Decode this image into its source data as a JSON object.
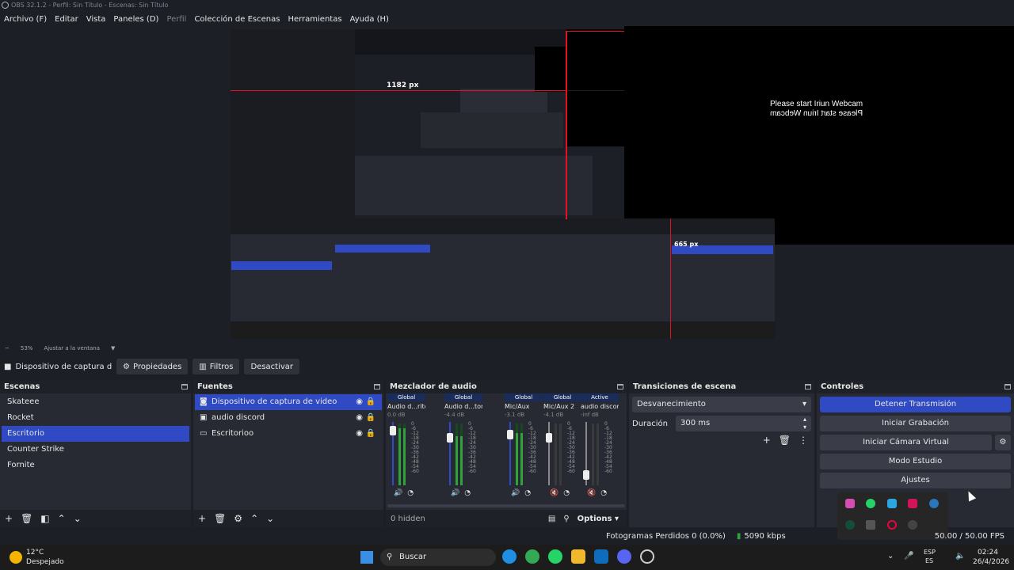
{
  "window": {
    "title": "OBS 32.1.2 - Perfil: Sin Título - Escenas: Sin Título"
  },
  "menu": [
    "Archivo (F)",
    "Editar",
    "Vista",
    "Paneles (D)",
    "Perfil",
    "Colección de Escenas",
    "Herramientas",
    "Ayuda (H)"
  ],
  "preview": {
    "iriun_text": "Please start Iriun Webcam",
    "measure_h": "1182 px",
    "measure_v": "665 px",
    "zoom": "53%",
    "fit_label": "Ajustar a la ventana"
  },
  "toolbar": {
    "source_name": "Dispositivo de captura de v",
    "properties": "Propiedades",
    "filters": "Filtros",
    "deactivate": "Desactivar"
  },
  "scenes": {
    "title": "Escenas",
    "items": [
      "Skateee",
      "Rocket",
      "Escritorio",
      "Counter Strike",
      "Fornite"
    ],
    "selected": "Escritorio"
  },
  "sources": {
    "title": "Fuentes",
    "items": [
      "Dispositivo de captura de video",
      "audio discord",
      "Escritorioo"
    ],
    "selected": "Dispositivo de captura de video"
  },
  "mixer": {
    "title": "Mezclador de audio",
    "channels": [
      {
        "head": "Global",
        "name": "Audio d...ritorio",
        "db": "0.0 dB",
        "level": 0.92,
        "fader": 0.92,
        "muted": false
      },
      {
        "head": "Global",
        "name": "Audio d...torio 2",
        "db": "-4.4 dB",
        "level": 0.8,
        "fader": 0.8,
        "muted": false
      },
      {
        "head": "Global",
        "name": "Mic/Aux",
        "db": "-3.1 dB",
        "level": 0.85,
        "fader": 0.85,
        "muted": false
      },
      {
        "head": "Global",
        "name": "Mic/Aux 2",
        "db": "-4.1 dB",
        "level": 0.0,
        "fader": 0.8,
        "muted": true
      },
      {
        "head": "Active",
        "name": "audio discord",
        "db": "-inf dB",
        "level": 0.0,
        "fader": 0.1,
        "muted": true
      }
    ],
    "ticks": [
      "0",
      "-6",
      "-12",
      "-18",
      "-24",
      "-30",
      "-36",
      "-42",
      "-48",
      "-54",
      "-60"
    ],
    "hidden": "0 hidden",
    "options": "Options"
  },
  "transitions": {
    "title": "Transiciones de escena",
    "selected": "Desvanecimiento",
    "duration_label": "Duración",
    "duration_value": "300 ms"
  },
  "controls": {
    "title": "Controles",
    "stop_stream": "Detener Transmisión",
    "start_record": "Iniciar Grabación",
    "start_vcam": "Iniciar Cámara Virtual",
    "studio_mode": "Modo Estudio",
    "settings": "Ajustes"
  },
  "status": {
    "dropped": "Fotogramas Perdidos 0 (0.0%)",
    "bitrate": "5090 kbps",
    "fps": "50.00 / 50.00 FPS"
  },
  "taskbar": {
    "weather_temp": "12°C",
    "weather_desc": "Despejado",
    "search": "Buscar",
    "lang": "ESP",
    "lang2": "ES",
    "time": "02:24",
    "date": "26/4/2026"
  },
  "colors": {
    "accent": "#2f4ac2",
    "panel": "#272a33",
    "bg": "#1d1f26",
    "red": "#e81123"
  }
}
